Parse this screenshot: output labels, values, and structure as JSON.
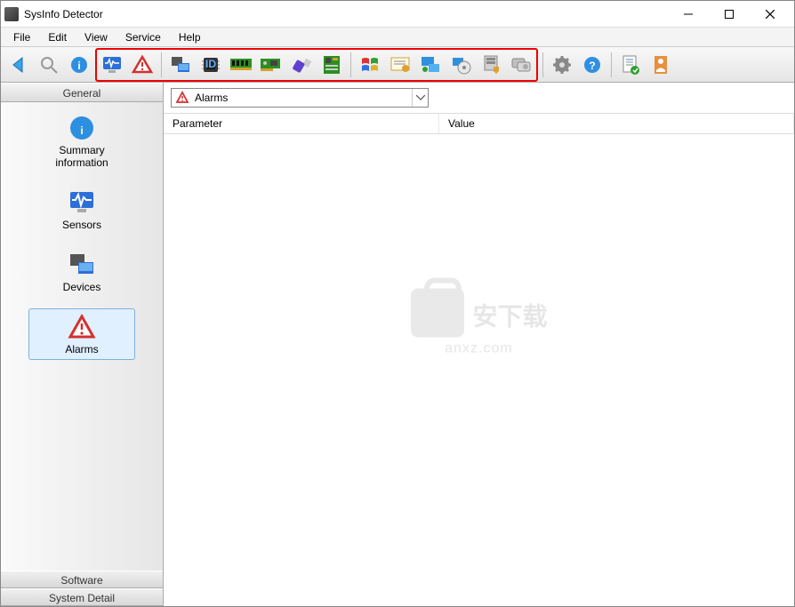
{
  "window": {
    "title": "SysInfo Detector"
  },
  "menu": {
    "items": [
      "File",
      "Edit",
      "View",
      "Service",
      "Help"
    ]
  },
  "toolbar": {
    "icons": [
      "back-arrow",
      "search",
      "info",
      "monitor-wave",
      "alarm-triangle",
      "devices-stack",
      "cpu-id-chip",
      "ram-module",
      "expansion-card",
      "usb-plug",
      "motherboard",
      "windows-logo",
      "license-cert",
      "network-monitor",
      "disc-drive",
      "server-shield",
      "hard-drives",
      "gear-settings",
      "help-question",
      "report-check",
      "user-profile"
    ]
  },
  "sidebar": {
    "sections": {
      "general": {
        "title": "General",
        "items": [
          {
            "label": "Summary information",
            "icon": "info-blue"
          },
          {
            "label": "Sensors",
            "icon": "monitor-wave"
          },
          {
            "label": "Devices",
            "icon": "devices-stack"
          },
          {
            "label": "Alarms",
            "icon": "alarm-triangle",
            "selected": true
          }
        ]
      },
      "software": {
        "title": "Software"
      },
      "system_detail": {
        "title": "System Detail"
      }
    }
  },
  "main": {
    "combo": {
      "icon": "alarm-triangle",
      "value": "Alarms"
    },
    "columns": {
      "param": "Parameter",
      "value": "Value"
    }
  },
  "watermark": {
    "cn": "安下载",
    "url": "anxz.com"
  }
}
